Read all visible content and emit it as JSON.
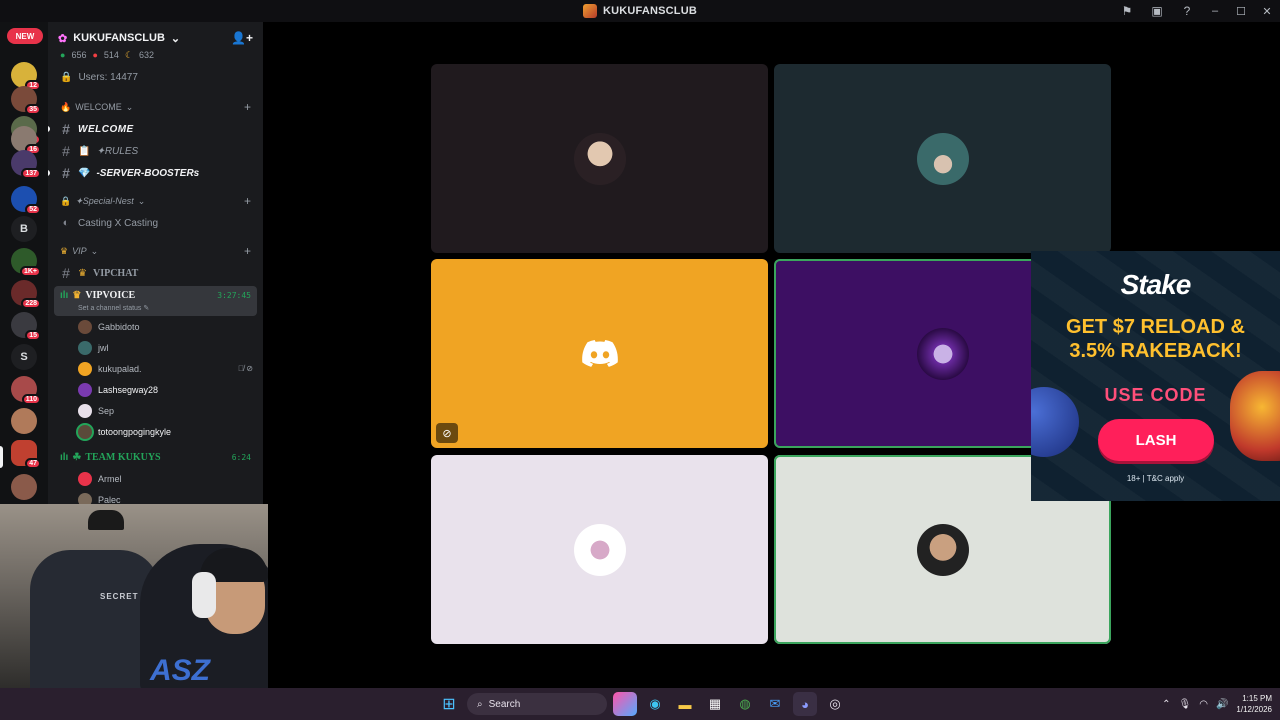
{
  "window": {
    "title": "KUKUFANSCLUB"
  },
  "rail": {
    "new_label": "NEW",
    "servers": [
      {
        "badge": "12"
      },
      {
        "badge": "35"
      },
      {
        "badge": "11"
      },
      {
        "badge": "16"
      },
      {
        "badge": "137"
      },
      {
        "badge": "52"
      },
      {
        "letter": "B"
      },
      {
        "badge": "1K+"
      },
      {
        "badge": "228"
      },
      {
        "badge": "15"
      },
      {
        "letter": "S"
      },
      {
        "badge": "110"
      },
      {
        "badge": ""
      },
      {
        "badge": "47"
      },
      {
        "badge": ""
      }
    ]
  },
  "server": {
    "name": "KUKUFANSCLUB",
    "stats": {
      "online": "656",
      "dnd": "514",
      "idle": "632"
    },
    "users_label": "Users: 14477"
  },
  "categories": {
    "welcome": "WELCOME",
    "special": "✦Special-Nest",
    "vip": "VIP"
  },
  "channels": {
    "welcome": "WELCOME",
    "rules": "✦RULES",
    "boosters": "-SERVER-BOOSTERs",
    "casting": "Casting X Casting",
    "vipchat": "VIPCHAT",
    "vipvoice": "VIPVOICE",
    "vipvoice_status": "Set a channel status",
    "vipvoice_timer": "3:27:45",
    "team": "TEAM KUKUYS",
    "team_timer": "6:24"
  },
  "voice_members": [
    {
      "name": "Gabbidoto"
    },
    {
      "name": "jwl"
    },
    {
      "name": "kukupalad."
    },
    {
      "name": "Lashsegway28"
    },
    {
      "name": "Sep"
    },
    {
      "name": "totoongpogingkyle"
    }
  ],
  "team_members": [
    {
      "name": "Armel"
    },
    {
      "name": "Palec"
    }
  ],
  "ad": {
    "brand": "Stake",
    "headline_1": "GET $7 RELOAD &",
    "headline_2": "3.5% RAKEBACK!",
    "code_label": "USE CODE",
    "code": "LASH",
    "legal": "18+ | T&C apply"
  },
  "webcam": {
    "chair_text": "SECRET LAB",
    "shirt_text": "ASZ"
  },
  "taskbar": {
    "search_placeholder": "Search",
    "time": "1:15 PM",
    "date": "1/12/2026"
  },
  "colors": {
    "tile_orange": "#f0a423",
    "tile_purple": "#3d0f63",
    "speaking": "#3ba55d",
    "ad_accent": "#ff1f5a"
  }
}
